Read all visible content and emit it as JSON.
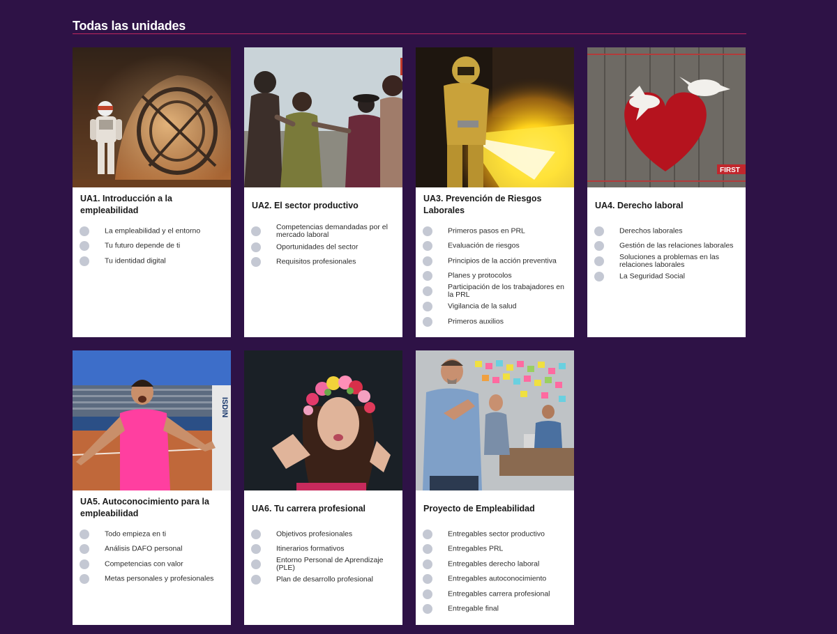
{
  "section": {
    "title": "Todas las unidades"
  },
  "colors": {
    "background": "#2e1246",
    "accent_rule": "#c0265e",
    "card": "#ffffff",
    "bullet": "#c4c8d3"
  },
  "units": [
    {
      "title": "UA1. Introducción a la empleabilidad",
      "image": "astronaut-in-spaceship-hangar-photo",
      "items": [
        "La empleabilidad y el entorno",
        "Tu futuro depende de ti",
        "Tu identidad digital"
      ]
    },
    {
      "title": "UA2. El sector productivo",
      "image": "vintage-women-dancing-photo",
      "items": [
        "Competencias demandadas por el mercado laboral",
        "Oportunidades del sector",
        "Requisitos profesionales"
      ]
    },
    {
      "title": "UA3. Prevención de Riesgos Laborales",
      "image": "protective-suit-flamethrower-photo",
      "items": [
        "Primeros pasos en PRL",
        "Evaluación de riesgos",
        "Principios de la acción preventiva",
        "Planes y protocolos",
        "Participación de los trabajadores en la PRL",
        "Vigilancia de la salud",
        "Primeros auxilios"
      ]
    },
    {
      "title": "UA4. Derecho laboral",
      "image": "heart-and-doves-on-wood-photo",
      "image_text": "FIRST",
      "items": [
        "Derechos laborales",
        "Gestión de las relaciones laborales",
        "Soluciones a problemas en las relaciones laborales",
        "La Seguridad Social"
      ]
    },
    {
      "title": "UA5. Autoconocimiento para la empleabilidad",
      "image": "tennis-player-celebrating-photo",
      "image_text": "ISDIN",
      "items": [
        "Todo empieza en ti",
        "Análisis DAFO personal",
        "Competencias con valor",
        "Metas personales y profesionales"
      ]
    },
    {
      "title": "UA6. Tu carrera profesional",
      "image": "woman-with-flower-crown-photo",
      "items": [
        "Objetivos profesionales",
        "Itinerarios formativos",
        "Entorno Personal de Aprendizaje (PLE)",
        "Plan de desarrollo profesional"
      ]
    },
    {
      "title": "Proyecto de Empleabilidad",
      "image": "man-applauding-in-office-photo",
      "items": [
        "Entregables sector productivo",
        "Entregables PRL",
        "Entregables derecho laboral",
        "Entregables autoconocimiento",
        "Entregables carrera profesional",
        "Entregable final"
      ]
    }
  ]
}
